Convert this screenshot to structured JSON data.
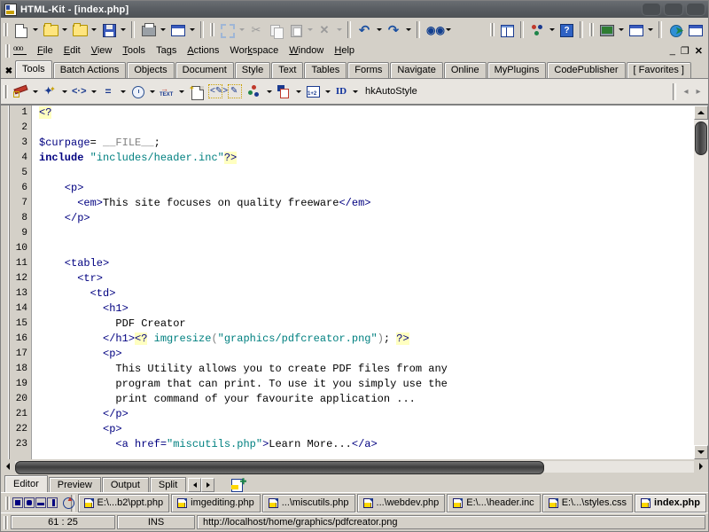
{
  "window": {
    "title": "HTML-Kit - [index.php]",
    "app_icon": "html-kit-document-icon",
    "minimize": "minimize-button",
    "restore": "restore-button",
    "close": "close-button"
  },
  "menu": {
    "logo": "html-kit-logo-icon",
    "items": [
      {
        "label": "File",
        "accel": "F"
      },
      {
        "label": "Edit",
        "accel": "E"
      },
      {
        "label": "View",
        "accel": "V"
      },
      {
        "label": "Tools",
        "accel": "T"
      },
      {
        "label": "Tags",
        "accel": "T"
      },
      {
        "label": "Actions",
        "accel": "A"
      },
      {
        "label": "Workspace",
        "accel": "k"
      },
      {
        "label": "Window",
        "accel": "W"
      },
      {
        "label": "Help",
        "accel": "H"
      }
    ]
  },
  "main_toolbar": {
    "groups": [
      {
        "buttons": [
          {
            "name": "new-file-button",
            "icon": "new-document-icon",
            "dropdown": true,
            "disabled": false
          },
          {
            "name": "open-file-button",
            "icon": "open-folder-icon",
            "dropdown": true,
            "disabled": false
          },
          {
            "name": "open-recent-button",
            "icon": "folder-star-icon",
            "dropdown": true,
            "disabled": false
          },
          {
            "name": "save-file-button",
            "icon": "floppy-disk-icon",
            "dropdown": true,
            "disabled": false
          }
        ]
      },
      {
        "buttons": [
          {
            "name": "print-button",
            "icon": "printer-icon",
            "dropdown": true,
            "disabled": false
          },
          {
            "name": "print-preview-button",
            "icon": "print-preview-icon",
            "dropdown": true,
            "disabled": false
          }
        ]
      },
      {
        "buttons": [
          {
            "name": "select-button",
            "icon": "select-region-icon",
            "dropdown": true,
            "disabled": true
          },
          {
            "name": "cut-button",
            "icon": "scissors-icon",
            "dropdown": false,
            "disabled": true
          },
          {
            "name": "copy-button",
            "icon": "copy-icon",
            "dropdown": false,
            "disabled": true
          },
          {
            "name": "paste-button",
            "icon": "paste-icon",
            "dropdown": true,
            "disabled": true
          },
          {
            "name": "delete-button",
            "icon": "delete-x-icon",
            "dropdown": true,
            "disabled": true
          }
        ]
      },
      {
        "buttons": [
          {
            "name": "undo-button",
            "icon": "undo-arrow-icon",
            "dropdown": true,
            "disabled": false
          },
          {
            "name": "redo-button",
            "icon": "redo-arrow-icon",
            "dropdown": true,
            "disabled": false
          }
        ]
      },
      {
        "buttons": [
          {
            "name": "find-button",
            "icon": "binoculars-icon",
            "dropdown": true,
            "disabled": false
          }
        ]
      }
    ],
    "right_groups": [
      {
        "buttons": [
          {
            "name": "split-view-button",
            "icon": "split-panes-icon",
            "dropdown": false,
            "disabled": false
          },
          {
            "name": "workspace-button",
            "icon": "workspace-nodes-icon",
            "dropdown": true,
            "disabled": false
          },
          {
            "name": "help-button",
            "icon": "question-mark-icon",
            "dropdown": false,
            "disabled": false
          }
        ]
      },
      {
        "buttons": [
          {
            "name": "preview-browser-button",
            "icon": "monitor-globe-icon",
            "dropdown": true,
            "disabled": false
          },
          {
            "name": "external-preview-button",
            "icon": "window-preview-icon",
            "dropdown": true,
            "disabled": false
          }
        ]
      },
      {
        "buttons": [
          {
            "name": "ftp-upload-button",
            "icon": "upload-globe-icon",
            "dropdown": false,
            "disabled": false
          },
          {
            "name": "plugins-button",
            "icon": "plugin-window-icon",
            "dropdown": false,
            "disabled": false
          }
        ]
      }
    ]
  },
  "plugin_tabs": {
    "close_label": "✖",
    "selected": "Tools",
    "items": [
      "Tools",
      "Batch Actions",
      "Objects",
      "Document",
      "Style",
      "Text",
      "Tables",
      "Forms",
      "Navigate",
      "Online",
      "MyPlugins",
      "CodePublisher",
      "[ Favorites ]"
    ]
  },
  "tools_toolbar": {
    "buttons": [
      {
        "name": "insert-tag-button",
        "icon": "red-wand-icon",
        "dropdown": true
      },
      {
        "name": "format-button",
        "icon": "magic-brush-icon",
        "dropdown": true
      },
      {
        "name": "code-snippet-button",
        "icon": "angle-brackets-icon",
        "dropdown": true
      },
      {
        "name": "align-button",
        "icon": "equals-lines-icon",
        "dropdown": true
      },
      {
        "name": "timer-button",
        "icon": "clock-icon",
        "dropdown": true
      },
      {
        "name": "text-tool-button",
        "icon": "text-arrow-icon",
        "dropdown": true
      },
      {
        "name": "new-page-button",
        "icon": "sparkle-page-icon",
        "dropdown": false
      },
      {
        "name": "edit-code-button",
        "icon": "pen-code-icon",
        "dropdown": false
      },
      {
        "name": "edit-selection-button",
        "icon": "pen-selection-icon",
        "dropdown": false
      },
      {
        "name": "color-picker-button",
        "icon": "rgb-dots-icon",
        "dropdown": true
      },
      {
        "name": "clipboard-tool-button",
        "icon": "clipboard-lock-icon",
        "dropdown": true
      },
      {
        "name": "numbered-list-button",
        "icon": "list-numbers-icon",
        "dropdown": true
      },
      {
        "name": "id-button",
        "icon": "id-label-icon",
        "dropdown": true
      }
    ],
    "style_label": "hkAutoStyle",
    "nav_prev": "scroll-left-arrow",
    "nav_next": "scroll-right-arrow"
  },
  "editor": {
    "lines": [
      {
        "n": 1,
        "tokens": [
          {
            "t": "<?",
            "c": "k-php"
          }
        ]
      },
      {
        "n": 2,
        "tokens": []
      },
      {
        "n": 3,
        "tokens": [
          {
            "t": "$curpage",
            "c": "k-var"
          },
          {
            "t": "= ",
            "c": "k-txt"
          },
          {
            "t": "__FILE__",
            "c": "k-const"
          },
          {
            "t": ";",
            "c": "k-txt"
          }
        ]
      },
      {
        "n": 4,
        "tokens": [
          {
            "t": "include",
            "c": "k-kw"
          },
          {
            "t": " ",
            "c": "k-txt"
          },
          {
            "t": "\"includes/header.inc\"",
            "c": "k-str"
          },
          {
            "t": "?>",
            "c": "k-php"
          }
        ]
      },
      {
        "n": 5,
        "tokens": []
      },
      {
        "n": 6,
        "tokens": [
          {
            "t": "    <p>",
            "c": "k-tag"
          }
        ]
      },
      {
        "n": 7,
        "tokens": [
          {
            "t": "      <em>",
            "c": "k-tag"
          },
          {
            "t": "This site focuses on quality freeware",
            "c": "k-txt"
          },
          {
            "t": "</em>",
            "c": "k-tag"
          }
        ]
      },
      {
        "n": 8,
        "tokens": [
          {
            "t": "    </p>",
            "c": "k-tag"
          }
        ]
      },
      {
        "n": 9,
        "tokens": []
      },
      {
        "n": 10,
        "tokens": []
      },
      {
        "n": 11,
        "tokens": [
          {
            "t": "    <table>",
            "c": "k-tag"
          }
        ]
      },
      {
        "n": 12,
        "tokens": [
          {
            "t": "      <tr>",
            "c": "k-tag"
          }
        ]
      },
      {
        "n": 13,
        "tokens": [
          {
            "t": "        <td>",
            "c": "k-tag"
          }
        ]
      },
      {
        "n": 14,
        "tokens": [
          {
            "t": "          <h1>",
            "c": "k-tag"
          }
        ]
      },
      {
        "n": 15,
        "tokens": [
          {
            "t": "            PDF Creator",
            "c": "k-txt"
          }
        ]
      },
      {
        "n": 16,
        "tokens": [
          {
            "t": "          </h1>",
            "c": "k-tag"
          },
          {
            "t": "<?",
            "c": "k-php"
          },
          {
            "t": " ",
            "c": "k-txt"
          },
          {
            "t": "imgresize",
            "c": "k-fn"
          },
          {
            "t": "(",
            "c": "k-punc"
          },
          {
            "t": "\"graphics/pdfcreator.png\"",
            "c": "k-str"
          },
          {
            "t": ")",
            "c": "k-punc"
          },
          {
            "t": "; ",
            "c": "k-txt"
          },
          {
            "t": "?>",
            "c": "k-php"
          }
        ]
      },
      {
        "n": 17,
        "tokens": [
          {
            "t": "          <p>",
            "c": "k-tag"
          }
        ]
      },
      {
        "n": 18,
        "tokens": [
          {
            "t": "            This Utility allows you to create PDF files from any",
            "c": "k-txt"
          }
        ]
      },
      {
        "n": 19,
        "tokens": [
          {
            "t": "            program that can print. To use it you simply use the",
            "c": "k-txt"
          }
        ]
      },
      {
        "n": 20,
        "tokens": [
          {
            "t": "            print command of your favourite application ...",
            "c": "k-txt"
          }
        ]
      },
      {
        "n": 21,
        "tokens": [
          {
            "t": "          </p>",
            "c": "k-tag"
          }
        ]
      },
      {
        "n": 22,
        "tokens": [
          {
            "t": "          <p>",
            "c": "k-tag"
          }
        ]
      },
      {
        "n": 23,
        "tokens": [
          {
            "t": "            <a href=",
            "c": "k-tag"
          },
          {
            "t": "\"miscutils.php\"",
            "c": "k-str"
          },
          {
            "t": ">",
            "c": "k-tag"
          },
          {
            "t": "Learn More...",
            "c": "k-txt"
          },
          {
            "t": "</a>",
            "c": "k-tag"
          }
        ]
      }
    ],
    "colors": {
      "tag": "#000080",
      "keyword": "#000080",
      "string": "#008080",
      "php_delimiter_background": "#ffffc0",
      "text": "#000000",
      "background": "#ffffff",
      "gutter_background": "#d4d0c8"
    },
    "scroll_up_arrow": "scroll-up-arrow",
    "scroll_down_arrow": "scroll-down-arrow",
    "hscroll_left_arrow": "scroll-left-arrow",
    "hscroll_right_arrow": "scroll-right-arrow"
  },
  "view_tabs": {
    "selected": "Editor",
    "items": [
      "Editor",
      "Preview",
      "Output",
      "Split"
    ],
    "extra_button": {
      "name": "add-view-button",
      "icon": "add-document-icon"
    }
  },
  "file_tabs": {
    "small_buttons": [
      {
        "name": "toggle-left-panel-button",
        "icon": "panel-left-icon"
      },
      {
        "name": "toggle-message-panel-button",
        "icon": "panel-message-icon"
      },
      {
        "name": "toggle-bottom-panel-button",
        "icon": "panel-bottom-icon"
      },
      {
        "name": "toggle-right-panel-button",
        "icon": "panel-right-icon"
      }
    ],
    "refresh_button": {
      "name": "refresh-button",
      "icon": "refresh-clock-icon"
    },
    "selected": "index.php",
    "items": [
      "E:\\...b2\\ppt.php",
      "imgediting.php",
      "...\\miscutils.php",
      "...\\webdev.php",
      "E:\\...\\header.inc",
      "E:\\...\\styles.css",
      "index.php"
    ]
  },
  "status_bar": {
    "cursor_position": "61 : 25",
    "insert_mode": "INS",
    "url": "http://localhost/home/graphics/pdfcreator.png"
  }
}
